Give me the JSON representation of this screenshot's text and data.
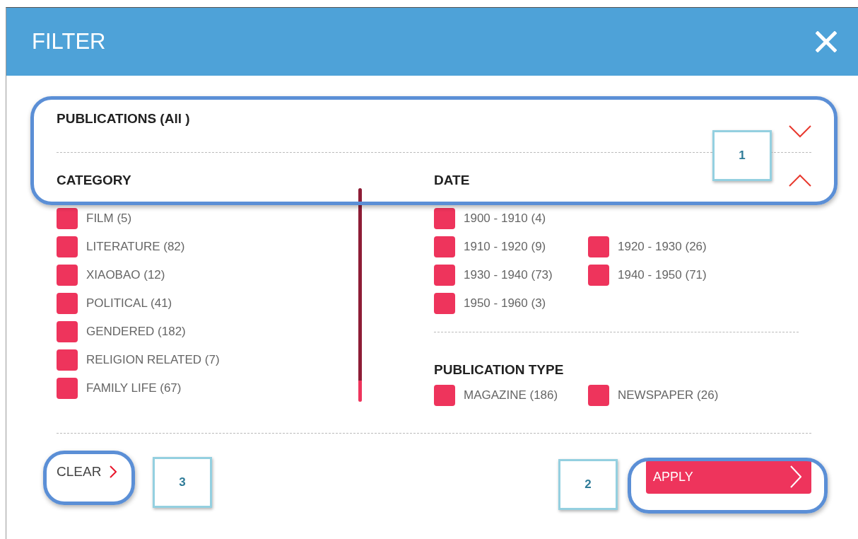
{
  "window": {
    "title": "FILTER"
  },
  "publications": {
    "label": "PUBLICATIONS (All )",
    "expanded": false
  },
  "category": {
    "label": "CATEGORY",
    "items": [
      {
        "label": "FILM (5)",
        "checked": true
      },
      {
        "label": "LITERATURE (82)",
        "checked": true
      },
      {
        "label": "XIAOBAO (12)",
        "checked": true
      },
      {
        "label": "POLITICAL (41)",
        "checked": true
      },
      {
        "label": "GENDERED (182)",
        "checked": true
      },
      {
        "label": "RELIGION RELATED (7)",
        "checked": true
      },
      {
        "label": "FAMILY LIFE (67)",
        "checked": true
      }
    ]
  },
  "date": {
    "label": "DATE",
    "expanded": true,
    "rows": [
      [
        {
          "label": "1900 - 1910 (4)",
          "checked": true
        }
      ],
      [
        {
          "label": "1910 - 1920 (9)",
          "checked": true
        },
        {
          "label": "1920 - 1930 (26)",
          "checked": true
        }
      ],
      [
        {
          "label": "1930 - 1940 (73)",
          "checked": true
        },
        {
          "label": "1940 - 1950 (71)",
          "checked": true
        }
      ],
      [
        {
          "label": "1950 - 1960 (3)",
          "checked": true
        }
      ]
    ]
  },
  "publication_type": {
    "label": "PUBLICATION TYPE",
    "items": [
      {
        "label": "MAGAZINE (186)",
        "checked": true
      },
      {
        "label": "NEWSPAPER (26)",
        "checked": true
      }
    ]
  },
  "buttons": {
    "clear": "CLEAR",
    "apply": "APPLY"
  },
  "annotations": [
    "1",
    "2",
    "3"
  ]
}
